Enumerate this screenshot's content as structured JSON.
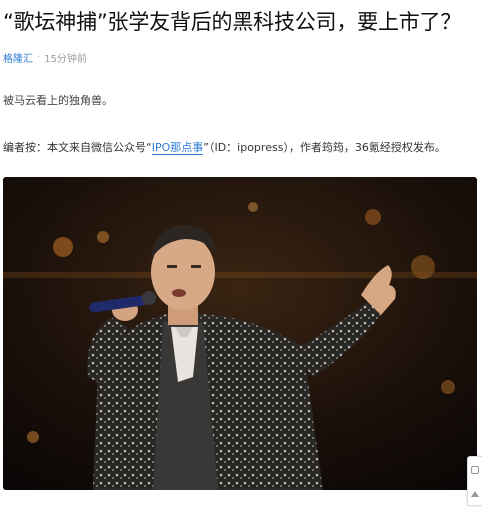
{
  "article": {
    "title": "“歌坛神捕”张学友背后的黑科技公司，要上市了？",
    "author": "格隆汇",
    "separator": "·",
    "time": "15分钟前",
    "summary": "被马云看上的独角兽。",
    "editor_prefix": "编者按：本文来自微信公众号“",
    "editor_link": "IPO那点事",
    "editor_suffix": "”（ID：ipopress），作者筠筠，36氪经授权发布。"
  },
  "image": {
    "description_icon": "concert-photo"
  },
  "side_widget": {
    "icons": [
      "feedback-icon",
      "back-to-top-icon"
    ]
  }
}
